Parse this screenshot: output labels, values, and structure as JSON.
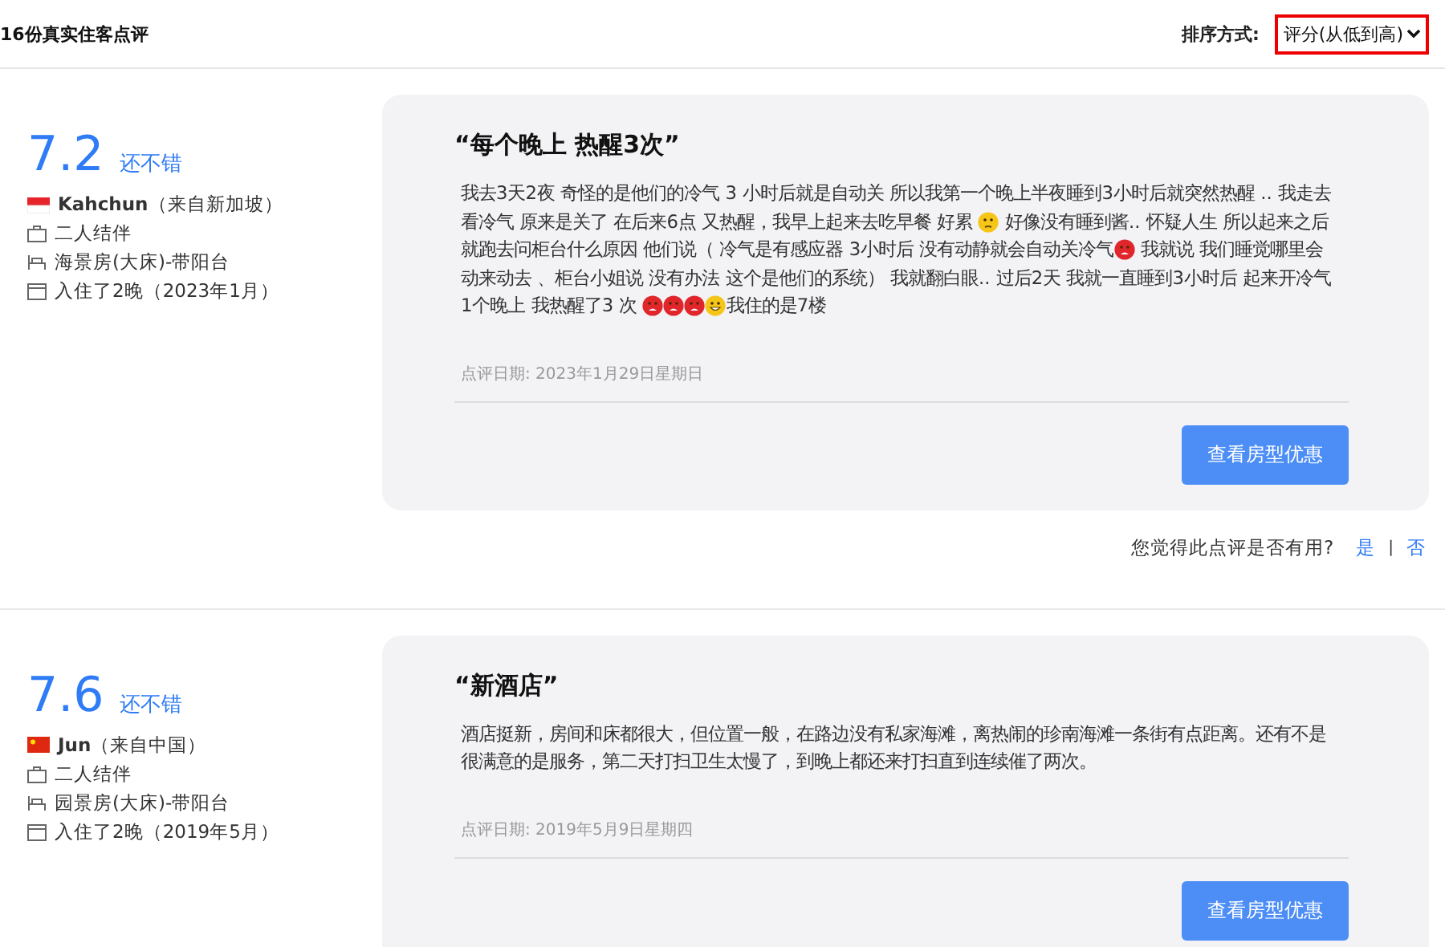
{
  "header": {
    "title": "16份真实住客点评",
    "sort_label": "排序方式:",
    "sort_value": "评分(从低到高)"
  },
  "reviews": [
    {
      "score": "7.2",
      "rating_word": "还不错",
      "flag": {
        "kind": "singapore"
      },
      "reviewer": "Kahchun",
      "origin": "（来自新加坡）",
      "traveler_type": "二人结伴",
      "room": "海景房(大床)-带阳台",
      "stay": "入住了2晚（2023年1月）",
      "title": "“每个晚上 热醒3次”",
      "body": [
        {
          "kind": "text",
          "text": "我去3天2夜 奇怪的是他们的冷气 3 小时后就是自动关 所以我第一个晚上半夜睡到3小时后就突然热醒 .. 我走去看冷气 原来是关了 在后来6点 又热醒，我早上起来去吃早餐 好累 "
        },
        {
          "kind": "pensive_emoji"
        },
        {
          "kind": "text",
          "text": " 好像没有睡到酱.. 怀疑人生 所以起来之后就跑去问柜台什么原因 他们说（ 冷气是有感应器 3小时后 没有动静就会自动关冷气"
        },
        {
          "kind": "angry_emoji"
        },
        {
          "kind": "text",
          "text": " 我就说 我们睡觉哪里会动来动去 、柜台小姐说 没有办法 这个是他们的系统） 我就翻白眼.. 过后2天 我就一直睡到3小时后 起来开冷气 1个晚上 我热醒了3 次 "
        },
        {
          "kind": "angry_emoji"
        },
        {
          "kind": "angry_emoji"
        },
        {
          "kind": "angry_emoji"
        },
        {
          "kind": "grin_emoji"
        },
        {
          "kind": "text",
          "text": "我住的是7楼"
        }
      ],
      "date": "点评日期: 2023年1月29日星期日",
      "button": "查看房型优惠",
      "helpful": {
        "question": "您觉得此点评是否有用?",
        "yes": "是",
        "separator": "|",
        "no": "否"
      }
    },
    {
      "score": "7.6",
      "rating_word": "还不错",
      "flag": {
        "kind": "china"
      },
      "reviewer": "Jun",
      "origin": "（来自中国）",
      "traveler_type": "二人结伴",
      "room": "园景房(大床)-带阳台",
      "stay": "入住了2晚（2019年5月）",
      "title": "“新酒店”",
      "body": [
        {
          "kind": "text",
          "text": "酒店挺新，房间和床都很大，但位置一般，在路边没有私家海滩，离热闹的珍南海滩一条街有点距离。还有不是很满意的是服务，第二天打扫卫生太慢了，到晚上都还来打扫直到连续催了两次。"
        }
      ],
      "date": "点评日期: 2019年5月9日星期四",
      "button": "查看房型优惠"
    }
  ]
}
